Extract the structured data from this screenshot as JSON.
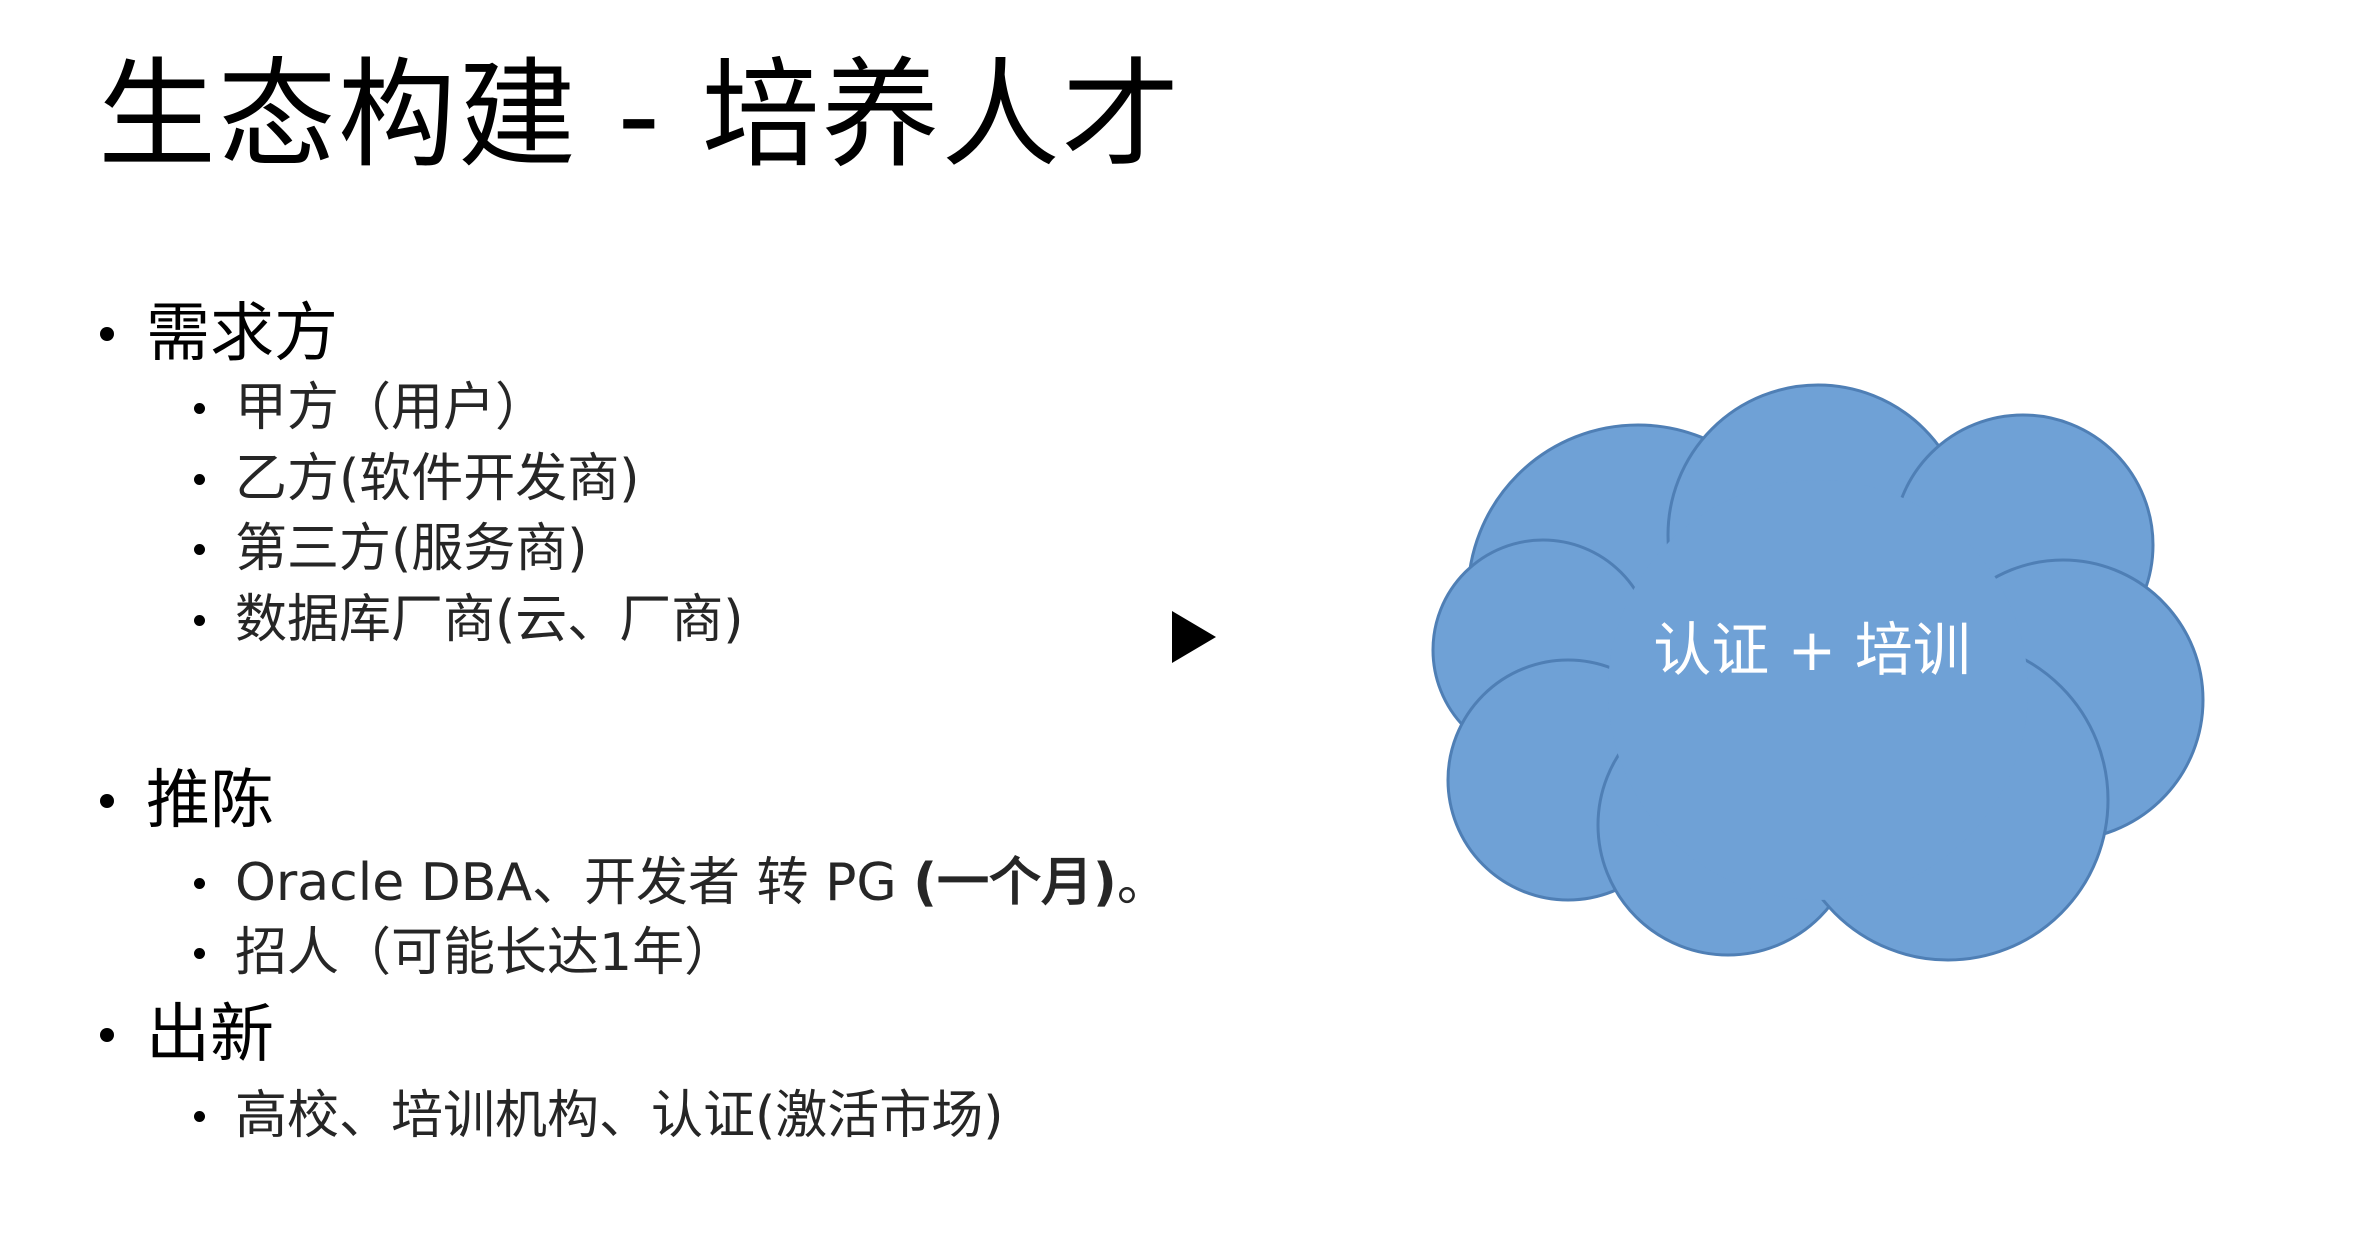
{
  "slide": {
    "title": "生态构建 - 培养人才"
  },
  "sections": [
    {
      "heading": "需求方",
      "items": [
        "甲方（用户）",
        "乙方(软件开发商)",
        "第三方(服务商)",
        "数据库厂商(云、厂商)"
      ]
    },
    {
      "heading": "推陈",
      "items": [
        {
          "prefix": "Oracle DBA、开发者 转 PG ",
          "bold": "(一个月)",
          "suffix": "。"
        },
        "招人（可能长达1年）"
      ]
    },
    {
      "heading": "出新",
      "items": [
        "高校、培训机构、认证(激活市场)"
      ]
    }
  ],
  "arrow": {
    "icon": "play-triangle-icon"
  },
  "cloud": {
    "label": "认证 + 培训",
    "fill_color": "#6fa1d6",
    "stroke_color": "#4f7fb5",
    "text_color": "#ffffff"
  }
}
